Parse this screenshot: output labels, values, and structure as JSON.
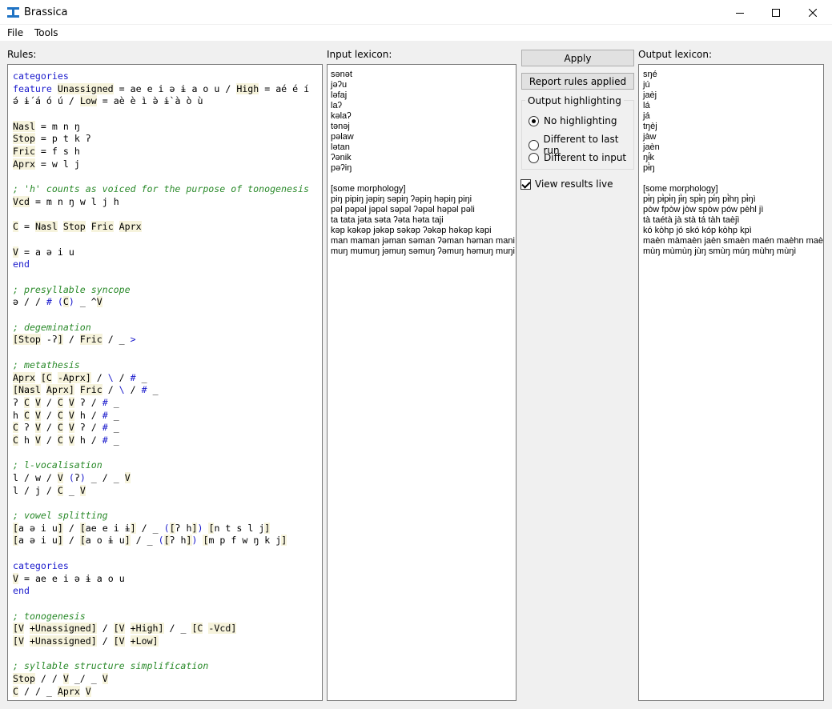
{
  "window": {
    "title": "Brassica"
  },
  "menu": {
    "file": "File",
    "tools": "Tools"
  },
  "labels": {
    "rules": "Rules:",
    "input": "Input lexicon:",
    "output": "Output lexicon:"
  },
  "buttons": {
    "apply": "Apply",
    "report": "Report rules applied"
  },
  "highlighting": {
    "title": "Output highlighting",
    "options": [
      "No highlighting",
      "Different to last run",
      "Different to input"
    ],
    "selected": "No highlighting"
  },
  "live": {
    "label": "View results live",
    "checked": true
  },
  "rules_lines": [
    "categories",
    "feature Unassigned = ae e i ə ɨ a o u / High = aé é í",
    "ə́ ɨ́ á ó ú / Low = aè è ì ə̀ ɨ̀ à ò ù",
    "",
    "Nasl = m n ŋ",
    "Stop = p t k ʔ",
    "Fric = f s h",
    "Aprx = w l j",
    "",
    "; 'h' counts as voiced for the purpose of tonogenesis",
    "Vcd = m n ŋ w l j h",
    "",
    "C = Nasl Stop Fric Aprx",
    "",
    "V = a ə i u",
    "end",
    "",
    "; presyllable syncope",
    "ə / / # (C) _ ^V",
    "",
    "; degemination",
    "[Stop -ʔ] / Fric / _ >",
    "",
    "; metathesis",
    "Aprx [C -Aprx] / \\ / # _",
    "[Nasl Aprx] Fric / \\ / # _",
    "ʔ C V / C V ʔ / # _",
    "h C V / C V h / # _",
    "C ʔ V / C V ʔ / # _",
    "C h V / C V h / # _",
    "",
    "; l-vocalisation",
    "l / w / V (ʔ) _ / _ V",
    "l / j / C _ V",
    "",
    "; vowel splitting",
    "[a ə i u] / [ae e i ɨ] / _ ([ʔ h]) [n t s l j]",
    "[a ə i u] / [a o ɨ u] / _ ([ʔ h]) [m p f w ŋ k j]",
    "",
    "categories",
    "V = ae e i ə ɨ a o u",
    "end",
    "",
    "; tonogenesis",
    "[V +Unassigned] / [V +High] / _ [C -Vcd]",
    "[V +Unassigned] / [V +Low]",
    "",
    "; syllable structure simplification",
    "Stop / / V _/ _ V",
    "C / / _ Aprx V"
  ],
  "input_lines": [
    "sənət",
    "jəʔu",
    "ləfaj",
    "laʔ",
    "kəlaʔ",
    "tənəj",
    "pəlaw",
    "lətan",
    "ʔənik",
    "pəʔiŋ",
    "",
    "[some morphology]",
    "piŋ pipiŋ jəpiŋ səpiŋ ʔəpiŋ həpiŋ piŋi",
    "pəl pəpəl jəpəl səpəl ʔəpəl həpəl pəli",
    "ta tata jəta səta ʔəta həta taji",
    "kəp kəkəp jəkəp səkəp ʔəkəp həkəp kəpi",
    "man maman jəman səman ʔəman həman mani",
    "muŋ mumuŋ jəmuŋ səmuŋ ʔəmuŋ həmuŋ muŋi"
  ],
  "output_lines": [
    "sŋé",
    "jú",
    "jaèj",
    "lá",
    "já",
    "tŋèj",
    "jàw",
    "jaèn",
    "ŋɨ́k",
    "pɨ̀ŋ",
    "",
    "[some morphology]",
    "pɨ̀ŋ pɨ̀pɨ̀ŋ jɨ̀ŋ spɨ̀ŋ pɨ́ŋ pɨ̀hŋ pɨ̀ŋì",
    "pòw fpòw jòw spòw pów pèhl jì",
    "tà taétà jà stà tá tàh taèjì",
    "kó kòhp jó skó kóp kòhp kpì",
    "maèn màmaèn jaèn smaèn maén maèhn maènì",
    "mùŋ mùmùŋ jùŋ smùŋ múŋ mùhŋ mùŋì"
  ]
}
